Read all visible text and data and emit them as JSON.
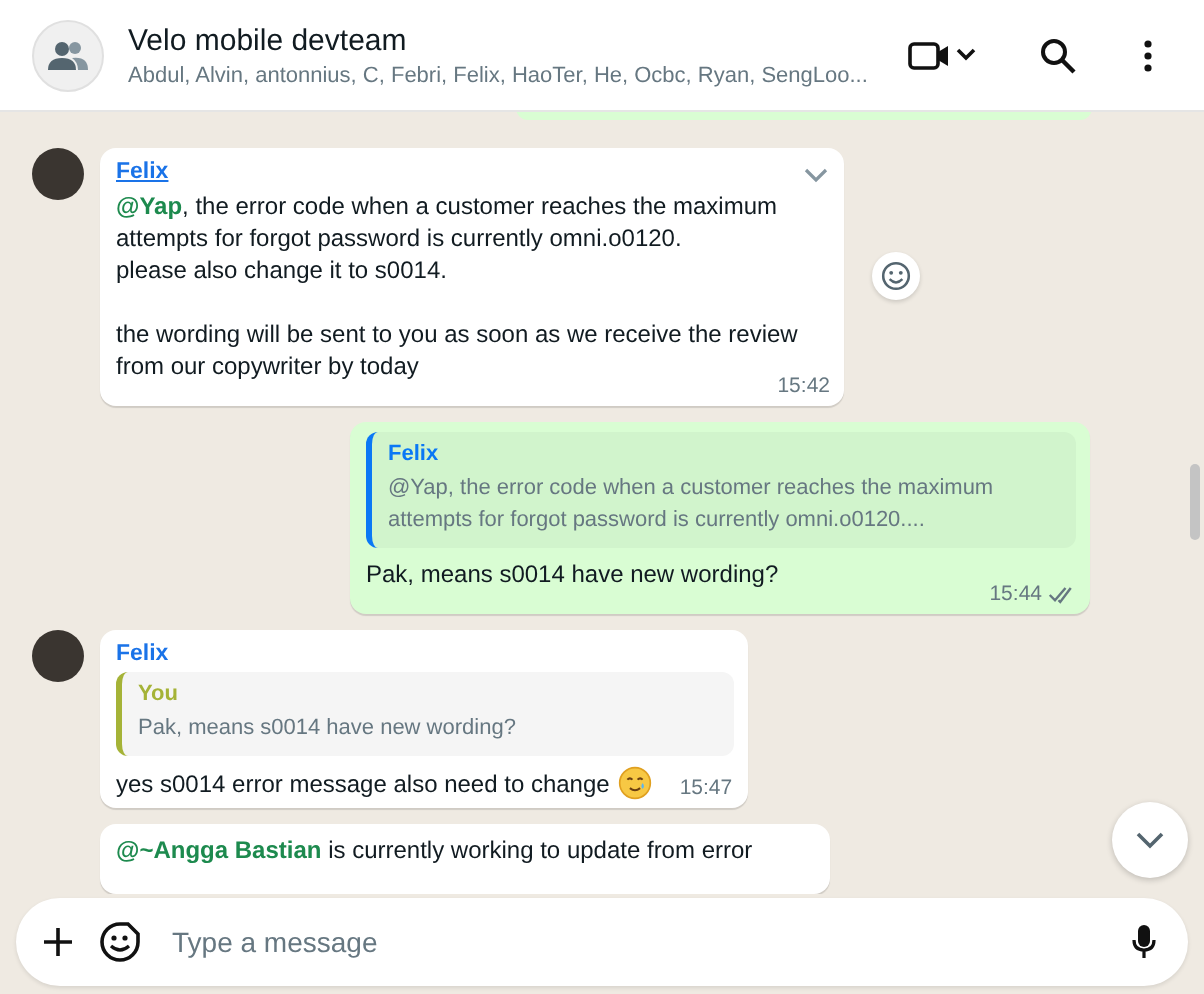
{
  "header": {
    "title": "Velo mobile devteam",
    "members": "Abdul, Alvin, antonnius, C, Febri, Felix, HaoTer, He, Ocbc, Ryan, SengLoo..."
  },
  "messages": [
    {
      "kind": "incoming",
      "sender": "Felix",
      "paragraphs": [
        [
          "**@Yap**, the error code when a customer reaches the maximum attempts for forgot password is currently omni.o0120.",
          "please also change it to s0014."
        ],
        [
          "the wording will be sent to you as soon as we receive the review from our copywriter by today"
        ]
      ],
      "time": "15:42"
    },
    {
      "kind": "outgoing",
      "quote": {
        "author": "Felix",
        "text": "@Yap, the error code when a customer reaches the maximum attempts for forgot password is currently omni.o0120...."
      },
      "paragraphs": [
        [
          "Pak, means s0014 have new wording?"
        ]
      ],
      "time": "15:44"
    },
    {
      "kind": "incoming",
      "sender": "Felix",
      "quote": {
        "author": "You",
        "text": "Pak, means s0014 have new wording?"
      },
      "paragraphs": [
        [
          "yes s0014 error message also need to change"
        ]
      ],
      "emoji": true,
      "time": "15:47"
    },
    {
      "kind": "partial",
      "paragraphs": [
        [
          "**@~Angga Bastian** is currently working to update from error"
        ]
      ]
    }
  ],
  "composer": {
    "placeholder": "Type a message"
  }
}
